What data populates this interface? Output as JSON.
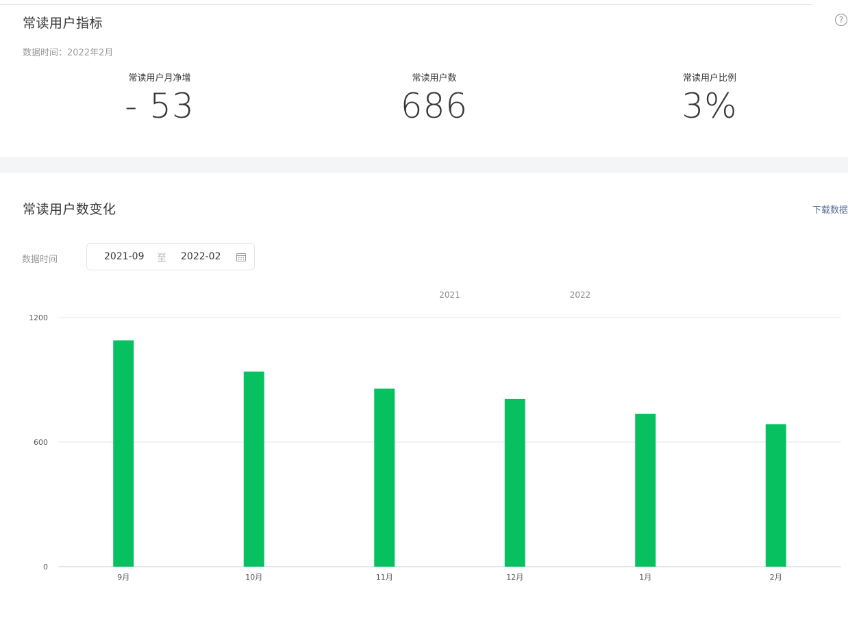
{
  "indicators": {
    "title": "常读用户指标",
    "help_icon": "question-circle-icon",
    "data_time_label": "数据时间：",
    "data_time_value": "2022年2月",
    "metrics": [
      {
        "label": "常读用户月净增",
        "value": "- 53"
      },
      {
        "label": "常读用户数",
        "value": "686"
      },
      {
        "label": "常读用户比例",
        "value": "3%"
      }
    ]
  },
  "trend": {
    "title": "常读用户数变化",
    "download_label": "下载数据",
    "filter_label": "数据时间",
    "date_start": "2021-09",
    "date_separator": "至",
    "date_end": "2022-02",
    "calendar_icon": "calendar-icon"
  },
  "colors": {
    "bar": "#07c160",
    "grid": "#e5e5e5",
    "axis": "#c8ccd4",
    "link": "#576b95"
  },
  "chart_data": {
    "type": "bar",
    "categories": [
      "9月",
      "10月",
      "11月",
      "12月",
      "1月",
      "2月"
    ],
    "year_labels": [
      {
        "label": "2021",
        "between": [
          "11月",
          "12月"
        ]
      },
      {
        "label": "2022",
        "between": [
          "12月",
          "1月"
        ]
      }
    ],
    "series": [
      {
        "values": [
          1090,
          940,
          858,
          808,
          736,
          686
        ]
      }
    ],
    "ylim": [
      0,
      1200
    ],
    "yticks": [
      0,
      600,
      1200
    ],
    "grid": true,
    "legend": "none"
  }
}
